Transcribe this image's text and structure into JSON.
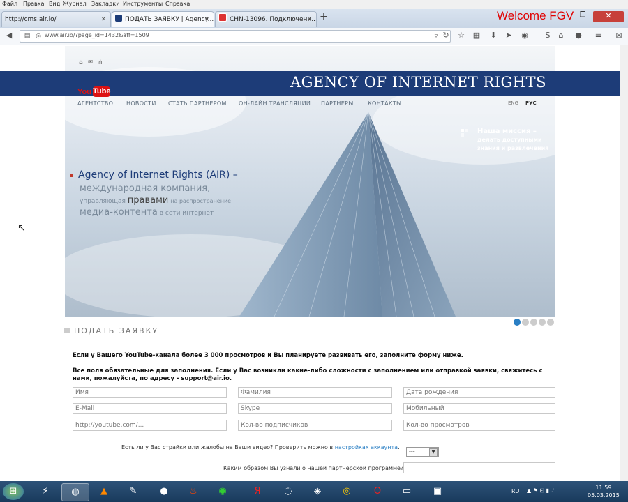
{
  "menu": [
    "Файл",
    "Правка",
    "Вид",
    "Журнал",
    "Закладки",
    "Инструменты",
    "Справка"
  ],
  "tabs": [
    {
      "label": "http://cms.air.io/"
    },
    {
      "label": "ПОДАТЬ ЗАЯВКУ | Agency..."
    },
    {
      "label": "CHN-13096. Подключени..."
    }
  ],
  "welcome": "Welcome FGV",
  "url": "www.air.io/?page_id=1432&aff=1509",
  "site": {
    "brand": "AGENCY OF INTERNET RIGHTS",
    "yt_you": "You",
    "yt_tube": "Tube",
    "nav": [
      "АГЕНТСТВО",
      "НОВОСТИ",
      "СТАТЬ ПАРТНЕРОМ",
      "ОН-ЛАЙН ТРАНСЛЯЦИИ",
      "ПАРТНЕРЫ",
      "КОНТАКТЫ"
    ],
    "lang_en": "ENG",
    "lang_ru": "РУС",
    "mission_title": "Наша миссия –",
    "mission_sub": "делать доступными знания и развлечения",
    "tag_line1": "Agency of Internet Rights (AIR) –",
    "tag_line2": "международная компания,",
    "tag_line3a": "управляющая",
    "tag_line3b": "правами",
    "tag_line3c": "на распространение",
    "tag_line4a": "медиа-контента",
    "tag_line4b": "в сети интернет",
    "slide_count": 5,
    "slide_active": 1
  },
  "form": {
    "title": "ПОДАТЬ ЗАЯВКУ",
    "intro": "Если у Вашего YouTube-канала более 3 000 просмотров и Вы планируете развивать его, заполните форму ниже.",
    "required": "Все поля обязательные для заполнения. Если у Вас возникли какие-либо сложности с заполнением или отправкой заявки, свяжитесь с нами, пожалуйста, по адресу - support@air.io.",
    "fields": [
      [
        "Имя",
        "Фамилия",
        "Дата рождения"
      ],
      [
        "E-Mail",
        "Skype",
        "Мобильный"
      ],
      [
        "http://youtube.com/...",
        "Кол-во подписчиков",
        "Кол-во просмотров"
      ]
    ],
    "strikes_q": "Есть ли у Вас страйки или жалобы на Ваши видео? Проверить можно в",
    "strikes_link": "настройках аккаунта",
    "strikes_end": ".",
    "select_value": "---",
    "how_q": "Каким образом Вы узнали о нашей партнерской программе?"
  },
  "taskbar": {
    "lang": "RU",
    "time": "11:59",
    "date": "05.03.2015"
  }
}
